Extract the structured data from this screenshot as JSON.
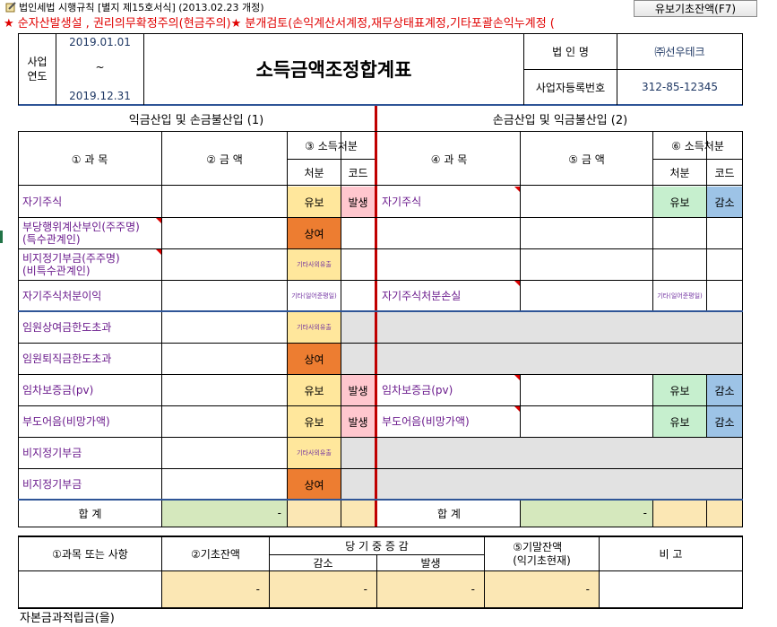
{
  "top_note": "법인세법 시행규칙 [별지 제15호서식] (2013.02.23 개정)",
  "btn_label": "유보기초잔액(F7)",
  "warning_text": "★ 순자산발생설 , 권리의무확정주의(현금주의)★ 분개검토(손익계산서계정,재무상태표계정,기타포괄손익누계정 (",
  "header": {
    "year_label": "사업\n연도",
    "period_start": "2019.01.01",
    "period_tilde": "~",
    "period_end": "2019.12.31",
    "title": "소득금액조정합계표",
    "corp_name_label": "법 인 명",
    "corp_name": "㈜선우테크",
    "reg_no_label": "사업자등록번호",
    "reg_no": "312-85-12345"
  },
  "left_section_title": "익금산입 및 손금불산입 (1)",
  "right_section_title": "손금산입 및 익금불산입 (2)",
  "cols": {
    "subj1": "① 과   목",
    "amt2": "② 금     액",
    "disp3": "③ 소득처분",
    "subj4": "④ 과   목",
    "amt5": "⑤ 금     액",
    "disp6": "⑥ 소득처분",
    "div": "처분",
    "code": "코드"
  },
  "rows": [
    {
      "ls": "자기주식",
      "ld": "유보",
      "lc": "발생",
      "rs": "자기주식",
      "rd": "유보",
      "rc": "감소"
    },
    {
      "ls": "부당행위계산부인(주주명)\n(특수관계인)",
      "ld": "상여",
      "lc": "",
      "rs": "",
      "rd": "",
      "rc": ""
    },
    {
      "ls": "비지정기부금(주주명)\n(비특수관계인)",
      "ld": "기타사외유출",
      "lc": "",
      "rs": "",
      "rd": "",
      "rc": ""
    },
    {
      "ls": "자기주식처분이익",
      "ld": "기타(일어준평일)",
      "lc": "",
      "rs": "자기주식처분손실",
      "rd": "기타(일어준평일)",
      "rc": ""
    },
    {
      "ls": "임원상여금한도초과",
      "ld": "기타사외유출",
      "lc": "",
      "rs": "",
      "rd": "",
      "rc": ""
    },
    {
      "ls": "임원퇴직금한도초과",
      "ld": "상여",
      "lc": "",
      "rs": "",
      "rd": "",
      "rc": ""
    },
    {
      "ls": "임차보증금(pv)",
      "ld": "유보",
      "lc": "발생",
      "rs": "임차보증금(pv)",
      "rd": "유보",
      "rc": "감소"
    },
    {
      "ls": "부도어음(비망가액)",
      "ld": "유보",
      "lc": "발생",
      "rs": "부도어음(비망가액)",
      "rd": "유보",
      "rc": "감소"
    },
    {
      "ls": "비지정기부금",
      "ld": "기타사외유출",
      "lc": "",
      "rs": "",
      "rd": "",
      "rc": ""
    },
    {
      "ls": "비지정기부금",
      "ld": "상여",
      "lc": "",
      "rs": "",
      "rd": "",
      "rc": ""
    }
  ],
  "total_label": "합     계",
  "total_left": "-",
  "total_right": "-",
  "lower": {
    "c1": "①과목 또는 사항",
    "c2": "②기초잔액",
    "c3": "당 기 중 증 감",
    "c3a": "감소",
    "c3b": "발생",
    "c5": "⑤기말잔액\n(익기초현재)",
    "c6": "비     고",
    "v2": "-",
    "v3a": "-",
    "v3b": "-",
    "v5": "-"
  },
  "footer_text": "자본금과적립금(을)"
}
